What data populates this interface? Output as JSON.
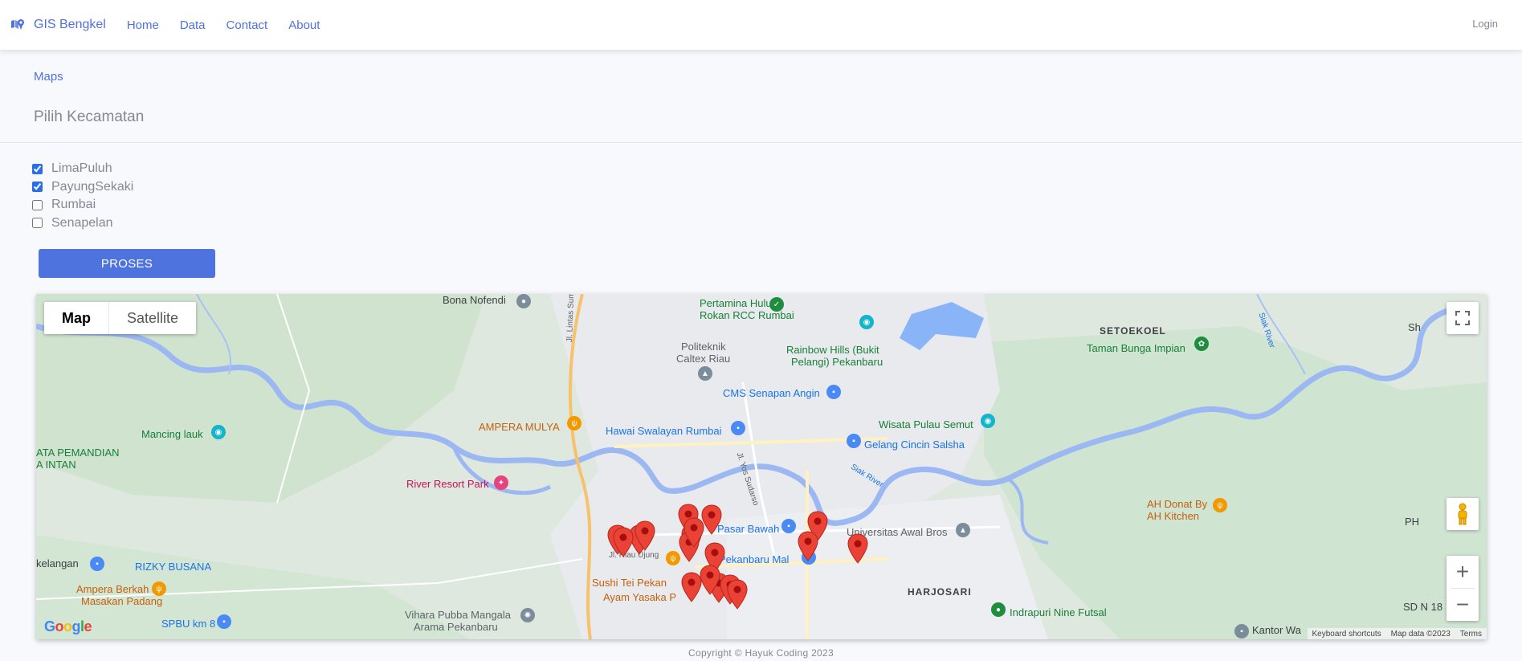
{
  "navbar": {
    "brand": "GIS Bengkel",
    "links": [
      "Home",
      "Data",
      "Contact",
      "About"
    ],
    "login": "Login"
  },
  "breadcrumb": "Maps",
  "section_title": "Pilih Kecamatan",
  "kecamatan": [
    {
      "label": "LimaPuluh",
      "checked": true
    },
    {
      "label": "PayungSekaki",
      "checked": true
    },
    {
      "label": "Rumbai",
      "checked": false
    },
    {
      "label": "Senapelan",
      "checked": false
    }
  ],
  "proses_button": "PROSES",
  "map": {
    "type_tabs": {
      "map": "Map",
      "satellite": "Satellite"
    },
    "labels": {
      "bona_nofendi": "Bona Nofendi",
      "pertamina": "Pertamina Hulu",
      "pertamina2": "Rokan RCC Rumbai",
      "politeknik": "Politeknik",
      "politeknik2": "Caltex Riau",
      "rainbow": "Rainbow Hills (Bukit",
      "rainbow2": "Pelangi) Pekanbaru",
      "setoekoel": "SETOEKOEL",
      "taman": "Taman Bunga Impian",
      "cms": "CMS Senapan Angin",
      "ampera_mulya": "AMPERA MULYA",
      "hawai": "Hawai Swalayan Rumbai",
      "wisata": "Wisata Pulau Semut",
      "gelang": "Gelang Cincin Salsha",
      "mancing": "Mancing lauk",
      "pemandian": "ATA PEMANDIAN",
      "pemandian2": "A INTAN",
      "river_resort": "River Resort Park",
      "jl_lintas": "Jl. Lintas Sumatra",
      "jl_yos": "Jl. Yos Sudarso",
      "siak_river": "Siak River",
      "siak_river2": "Siak River",
      "ah_donat": "AH Donat By",
      "ah_donat2": "AH Kitchen",
      "pasar_bawah": "Pasar Bawah",
      "universitas": "Universitas Awal Bros",
      "pekanbaru_mall": "Pekanbaru Mal",
      "jl_riau": "Jl. Riau Ujung",
      "kelangan": "kelangan",
      "rizky": "RIZKY BUSANA",
      "ampera_berkah": "Ampera Berkah",
      "ampera_berkah2": "Masakan Padang",
      "sushi": "Sushi Tei Pekan",
      "ayam": "Ayam Yasaka P",
      "harjosari": "HARJOSARI",
      "indrapuri": "Indrapuri Nine Futsal",
      "spbu": "SPBU km 8",
      "vihara": "Vihara Pubba Mangala",
      "vihara2": "Arama Pekanbaru",
      "kantor": "Kantor Wa",
      "sd": "SD N 18",
      "ph": "PH",
      "sh": "Sh",
      "jl_sumatra2": "Jl. Lintas Sumatra"
    },
    "attribution": {
      "shortcuts": "Keyboard shortcuts",
      "data": "Map data ©2023",
      "terms": "Terms"
    },
    "marker_count": 18
  },
  "footer": "Copyright © Hayuk Coding 2023"
}
